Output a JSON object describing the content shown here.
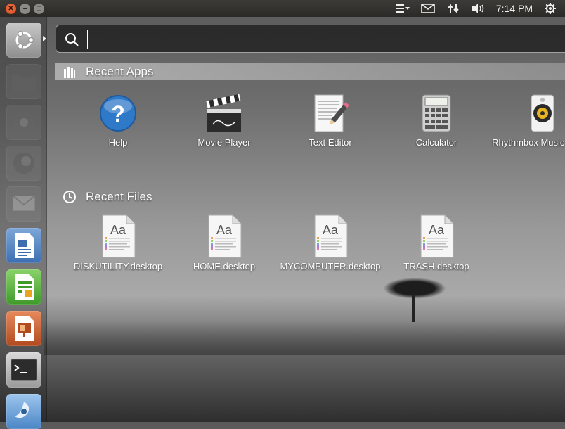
{
  "top_panel": {
    "clock": "7:14 PM",
    "window_buttons": [
      "close",
      "minimize",
      "maximize"
    ],
    "indicators": [
      "menu-icon",
      "mail-icon",
      "network-icon",
      "volume-icon",
      "power-gear-icon"
    ]
  },
  "launcher": {
    "items": [
      {
        "name": "ubuntu-dash-icon",
        "active": true
      },
      {
        "name": "files-folder-icon"
      },
      {
        "name": "chromium-icon"
      },
      {
        "name": "firefox-icon"
      },
      {
        "name": "mail-client-icon"
      },
      {
        "name": "libreoffice-writer-icon"
      },
      {
        "name": "libreoffice-calc-icon"
      },
      {
        "name": "libreoffice-impress-icon"
      },
      {
        "name": "terminal-icon"
      },
      {
        "name": "shotwell-icon"
      }
    ]
  },
  "search": {
    "placeholder": ""
  },
  "recent_apps": {
    "title": "Recent Apps",
    "items": [
      {
        "label": "Help",
        "icon": "help-icon"
      },
      {
        "label": "Movie Player",
        "icon": "clapperboard-icon"
      },
      {
        "label": "Text Editor",
        "icon": "text-editor-icon"
      },
      {
        "label": "Calculator",
        "icon": "calculator-icon"
      },
      {
        "label": "Rhythmbox Music Player",
        "icon": "speaker-icon"
      }
    ]
  },
  "recent_files": {
    "title": "Recent Files",
    "items": [
      {
        "label": "DISKUTILITY.desktop",
        "icon": "desktop-file-icon"
      },
      {
        "label": "HOME.desktop",
        "icon": "desktop-file-icon"
      },
      {
        "label": "MYCOMPUTER.desktop",
        "icon": "desktop-file-icon"
      },
      {
        "label": "TRASH.desktop",
        "icon": "desktop-file-icon"
      }
    ]
  },
  "colors": {
    "panel": "#3c3b37",
    "close_button": "#d8431b",
    "dash_overlay": "rgba(0,0,0,0.55)"
  }
}
